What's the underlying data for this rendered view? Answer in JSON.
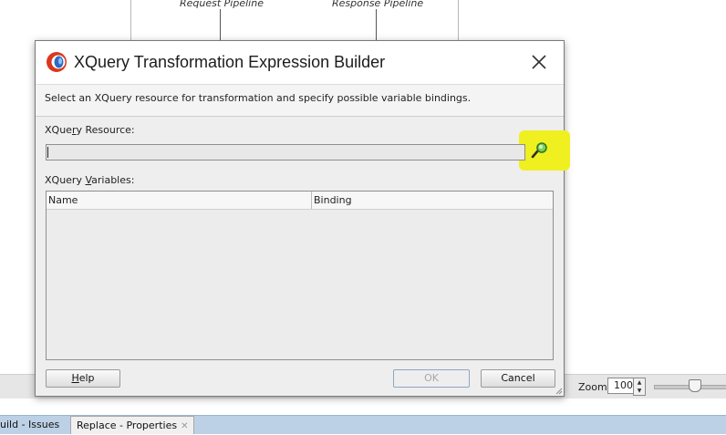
{
  "background": {
    "pipeline_labels": [
      "Request Pipeline",
      "Response Pipeline"
    ]
  },
  "dialog": {
    "title": "XQuery Transformation Expression Builder",
    "close_icon": "close-x-icon",
    "logo_icon": "oracle-jdeveloper-logo",
    "description": "Select an XQuery resource for transformation and specify possible variable bindings.",
    "resource_label_pre": "XQue",
    "resource_label_mnemonic": "r",
    "resource_label_post": "y Resource:",
    "resource_value": "",
    "browse_icon": "search-magnifier-icon",
    "highlight_color": "#f0f020",
    "variables_label_pre": "XQuery ",
    "variables_label_mnemonic": "V",
    "variables_label_post": "ariables:",
    "variables_table": {
      "columns": [
        "Name",
        "Binding"
      ],
      "rows": []
    },
    "help_button_mnemonic": "H",
    "help_button_rest": "elp",
    "ok_button": "OK",
    "cancel_button": "Cancel"
  },
  "status_bar": {
    "zoom_label": "Zoom:",
    "zoom_value": "100"
  },
  "bottom_tabs": [
    {
      "label": "uild - Issues",
      "active": false
    },
    {
      "label": "Replace - Properties",
      "active": true
    }
  ]
}
